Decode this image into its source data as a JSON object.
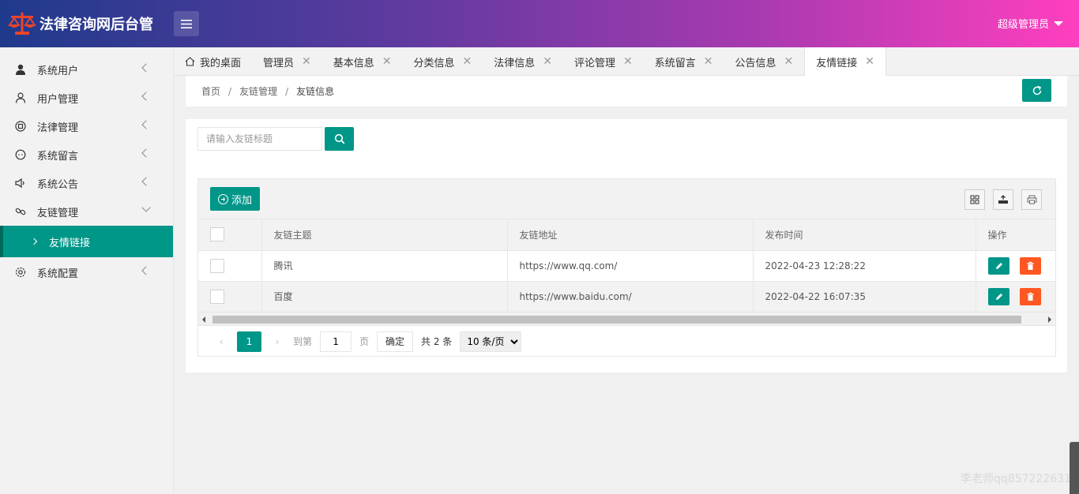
{
  "header": {
    "title": "法律咨询网后台管",
    "user": "超级管理员"
  },
  "colors": {
    "accent": "#009688",
    "danger": "#ff5722",
    "header_start": "#1f3a8c",
    "header_end": "#ff3fbf"
  },
  "sidebar": {
    "items": [
      {
        "label": "系统用户",
        "icon": "user-solid-icon"
      },
      {
        "label": "用户管理",
        "icon": "user-outline-icon"
      },
      {
        "label": "法律管理",
        "icon": "circle-icon"
      },
      {
        "label": "系统留言",
        "icon": "message-icon"
      },
      {
        "label": "系统公告",
        "icon": "speaker-icon"
      },
      {
        "label": "友链管理",
        "icon": "link-icon"
      },
      {
        "label": "系统配置",
        "icon": "gear-icon"
      }
    ],
    "active_sub": "友情链接"
  },
  "tabs": [
    {
      "label": "我的桌面"
    },
    {
      "label": "管理员"
    },
    {
      "label": "基本信息"
    },
    {
      "label": "分类信息"
    },
    {
      "label": "法律信息"
    },
    {
      "label": "评论管理"
    },
    {
      "label": "系统留言"
    },
    {
      "label": "公告信息"
    },
    {
      "label": "友情链接"
    }
  ],
  "breadcrumb": {
    "home": "首页",
    "section": "友链管理",
    "current": "友链信息",
    "sep": "/"
  },
  "search": {
    "placeholder": "请输入友链标题"
  },
  "toolbar": {
    "add_label": "添加"
  },
  "table": {
    "headers": [
      "友链主题",
      "友链地址",
      "发布时间",
      "操作"
    ],
    "rows": [
      {
        "title": "腾讯",
        "url": "https://www.qq.com/",
        "time": "2022-04-23 12:28:22"
      },
      {
        "title": "百度",
        "url": "https://www.baidu.com/",
        "time": "2022-04-22 16:07:35"
      }
    ]
  },
  "pager": {
    "current": "1",
    "goto_label": "到第",
    "goto_value": "1",
    "page_label": "页",
    "confirm": "确定",
    "total": "共 2 条",
    "per_page": "10 条/页"
  },
  "watermark": "李老师qq857222631"
}
